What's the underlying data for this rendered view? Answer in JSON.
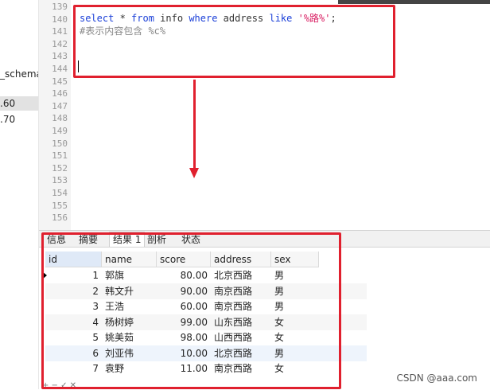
{
  "tree": {
    "schema_label": "_schema",
    "selected_label": ".60",
    "item_label": ".70"
  },
  "editor": {
    "line_numbers": [
      "139",
      "140",
      "141",
      "142",
      "143",
      "144",
      "145",
      "146",
      "147",
      "148",
      "149",
      "150",
      "151",
      "152",
      "153",
      "154",
      "155",
      "156"
    ],
    "line140": {
      "kw1": "select",
      "p1": " * ",
      "kw2": "from",
      "p2": " info ",
      "kw3": "where",
      "p3": " address ",
      "kw4": "like",
      "p4": " ",
      "str": "'%路%'",
      "p5": ";"
    },
    "line141": "#表示内容包含 %c%"
  },
  "results": {
    "tabs": [
      "信息",
      "摘要",
      "结果 1",
      "剖析",
      "状态"
    ],
    "active_tab": "结果 1",
    "columns": [
      "id",
      "name",
      "score",
      "address",
      "sex"
    ],
    "rows": [
      {
        "id": "1",
        "name": "郭旗",
        "score": "80.00",
        "address": "北京西路",
        "sex": "男"
      },
      {
        "id": "2",
        "name": "韩文升",
        "score": "90.00",
        "address": "南京西路",
        "sex": "男"
      },
      {
        "id": "3",
        "name": "王浩",
        "score": "60.00",
        "address": "南京西路",
        "sex": "男"
      },
      {
        "id": "4",
        "name": "杨树婷",
        "score": "99.00",
        "address": "山东西路",
        "sex": "女"
      },
      {
        "id": "5",
        "name": "姚美茹",
        "score": "98.00",
        "address": "山西西路",
        "sex": "女"
      },
      {
        "id": "6",
        "name": "刘亚伟",
        "score": "10.00",
        "address": "北京西路",
        "sex": "男"
      },
      {
        "id": "7",
        "name": "袁野",
        "score": "11.00",
        "address": "南京西路",
        "sex": "女"
      }
    ],
    "toolbar_glyphs": "+ − ✓ ✕"
  },
  "watermark": "CSDN @aaa.com",
  "colors": {
    "annotation_red": "#e0202e",
    "keyword_blue": "#1a3fd8",
    "string_pink": "#d81b60"
  }
}
